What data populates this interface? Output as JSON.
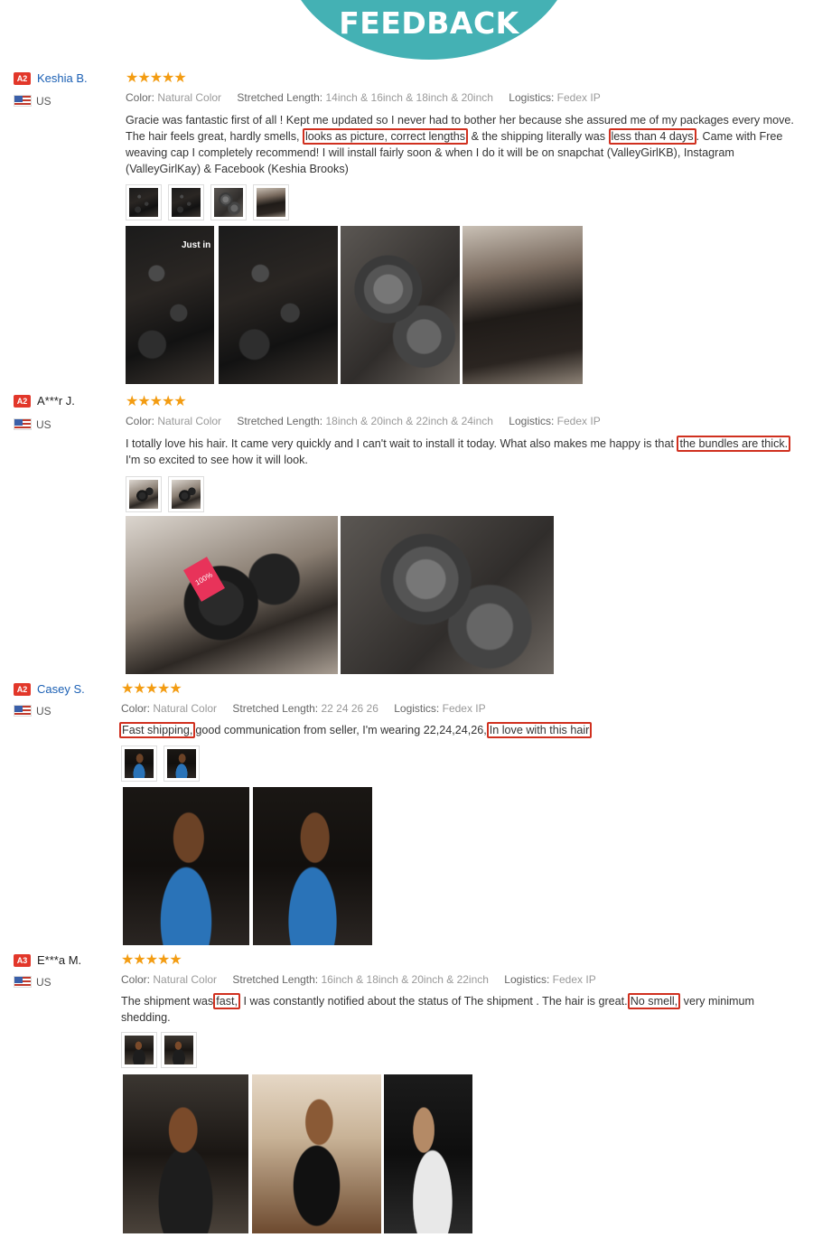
{
  "banner": {
    "title": "FEEDBACK"
  },
  "labels": {
    "color": "Color:",
    "length": "Stretched Length:",
    "logistics": "Logistics:"
  },
  "reviews": [
    {
      "level": "A2",
      "name": "Keshia B.",
      "country": "US",
      "stars": "★★★★★",
      "color": "Natural Color",
      "length": "14inch & 16inch & 18inch & 20inch",
      "logistics": "Fedex IP",
      "text": {
        "p1": "Gracie was fantastic first of all ! Kept me updated so I never had to bother her because she assured me of my packages every move. The hair feels great, hardly smells,",
        "h1": "looks as picture, correct lengths",
        "p2": "& the shipping literally was",
        "h2": "less than 4 days",
        "p3": ". Came with Free weaving cap I completely recommend! I will install fairly soon & when I do it will be on snapchat (ValleyGirlKB), Instagram (ValleyGirlKay) & Facebook (Keshia Brooks)"
      },
      "sticker": "Just in"
    },
    {
      "level": "A2",
      "name": "A***r J.",
      "country": "US",
      "stars": "★★★★★",
      "color": "Natural Color",
      "length": "18inch & 20inch & 22inch & 24inch",
      "logistics": "Fedex IP",
      "text": {
        "p1": "I totally love his hair. It came very quickly and I can't wait to install it today. What also makes me happy is that",
        "h1": "the bundles are thick.",
        "p2": "I'm so excited to see how it will look."
      },
      "tag": "100%"
    },
    {
      "level": "A2",
      "name": "Casey S.",
      "country": "US",
      "stars": "★★★★★",
      "color": "Natural Color",
      "length": "22 24 26 26",
      "logistics": "Fedex IP",
      "text": {
        "h1": "Fast shipping,",
        "p1": "good communication from seller, I'm wearing 22,24,24,26,",
        "h2": "In love with this hair"
      }
    },
    {
      "level": "A3",
      "name": "E***a M.",
      "country": "US",
      "stars": "★★★★★",
      "color": "Natural Color",
      "length": "16inch & 18inch & 20inch & 22inch",
      "logistics": "Fedex IP",
      "text": {
        "p1": "The shipment was",
        "h1": "fast,",
        "p2": "I was constantly notified about the status of The shipment . The hair is great.",
        "h2": "No smell,",
        "p3": "very minimum shedding."
      }
    }
  ]
}
